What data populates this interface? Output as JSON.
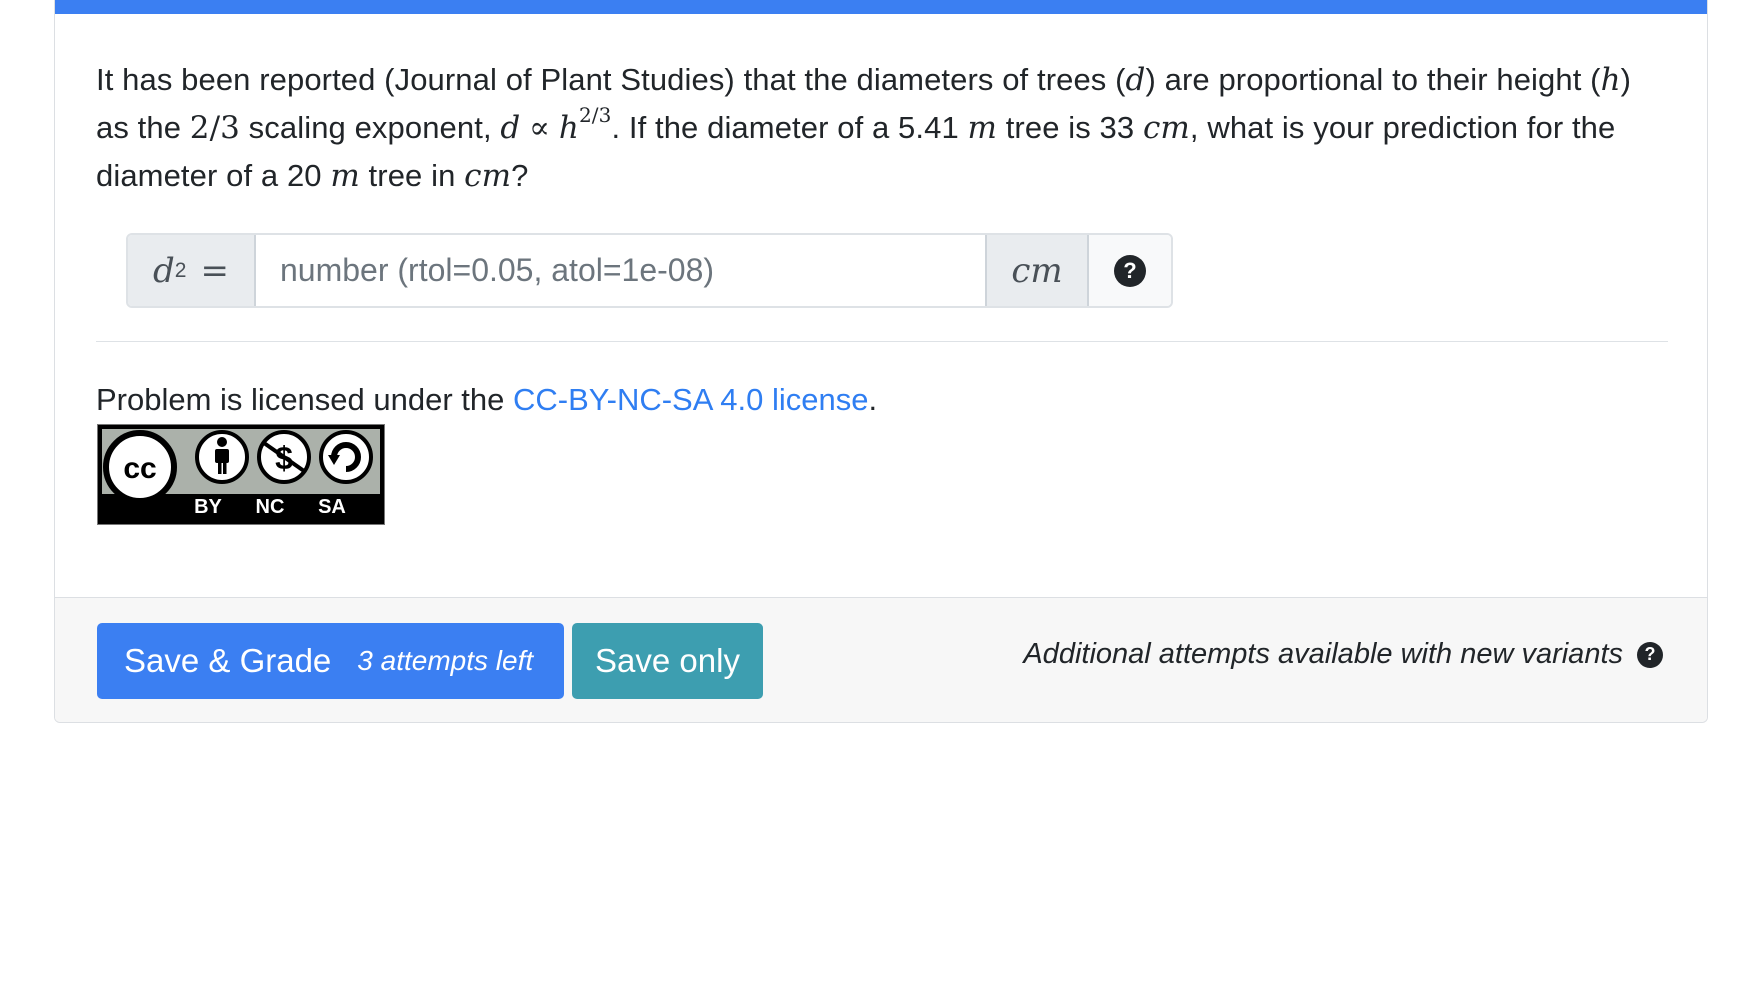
{
  "question": {
    "t1": "It has been reported (Journal of Plant Studies) that the diameters of trees (",
    "var_d": "d",
    "t2": ") are proportional to their height (",
    "var_h": "h",
    "t3": ") as the ",
    "frac": "2/3",
    "t4": " scaling exponent, ",
    "prop_lhs": "d",
    "prop_sym": "∝",
    "prop_base": "h",
    "prop_exp": "2/3",
    "t5": ". If the diameter of a 5.41 ",
    "unit_m1": "m",
    "t6": " tree is 33 ",
    "unit_cm1": "cm",
    "t7": ", what is your prediction for the diameter of a 20 ",
    "unit_m2": "m",
    "t8": " tree in ",
    "unit_cm2": "cm",
    "t9": "?"
  },
  "answer": {
    "label_var": "d",
    "label_sub": "2",
    "label_eq": "=",
    "placeholder": "number (rtol=0.05, atol=1e-08)",
    "value": "",
    "unit": "cm",
    "help_glyph": "?",
    "help_icon": "question-circle-icon"
  },
  "license": {
    "prefix": "Problem is licensed under the ",
    "link_text": "CC-BY-NC-SA 4.0 license",
    "suffix": ".",
    "badge": {
      "cc": "cc",
      "by": "BY",
      "nc": "NC",
      "sa": "SA"
    }
  },
  "footer": {
    "save_grade_label": "Save & Grade",
    "attempts_label": "3 attempts left",
    "save_only_label": "Save only",
    "note": "Additional attempts available with new variants",
    "note_help_glyph": "?"
  },
  "colors": {
    "primary": "#3b7ff2",
    "info": "#3d9eb0",
    "link": "#2f7ef2"
  }
}
